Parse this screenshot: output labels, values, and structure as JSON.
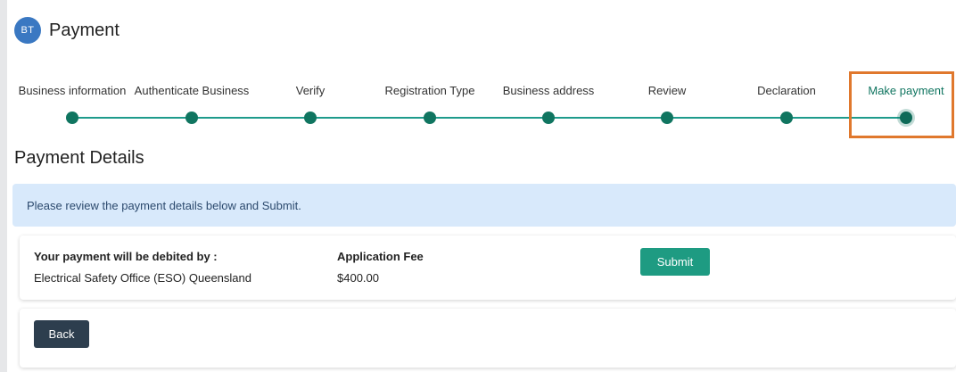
{
  "header": {
    "avatar_initials": "BT",
    "title": "Payment"
  },
  "stepper": {
    "steps": [
      {
        "label": "Business information"
      },
      {
        "label": "Authenticate Business"
      },
      {
        "label": "Verify"
      },
      {
        "label": "Registration Type"
      },
      {
        "label": "Business address"
      },
      {
        "label": "Review"
      },
      {
        "label": "Declaration"
      },
      {
        "label": "Make payment"
      }
    ],
    "active_step": "Make payment"
  },
  "section": {
    "title": "Payment Details"
  },
  "alert": {
    "message": "Please review the payment details below and Submit."
  },
  "payment": {
    "debited_by_label": "Your payment will be debited by :",
    "debited_by_value": "Electrical Safety Office (ESO) Queensland",
    "fee_label": "Application Fee",
    "fee_value": "$400.00",
    "submit_label": "Submit"
  },
  "actions": {
    "back_label": "Back"
  },
  "colors": {
    "accent": "#107560",
    "submit_button": "#1e9b82",
    "back_button": "#2d3e4e",
    "alert_bg": "#d8e9fb",
    "highlight": "#e0782d",
    "avatar": "#3a78c2"
  }
}
